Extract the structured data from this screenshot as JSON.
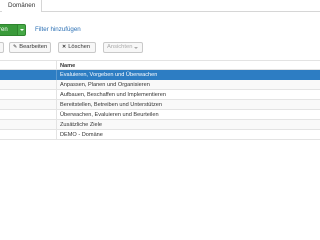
{
  "tabs": {
    "active_label": "Domänen"
  },
  "toolbar_top": {
    "add_label": "ren",
    "filter_link": "Filter hinzufügen"
  },
  "toolbar_actions": {
    "edit_label": "Bearbeiten",
    "delete_label": "Löschen",
    "views_label": "Ansichten"
  },
  "table": {
    "column_header": "Name",
    "rows": [
      {
        "name": "Evaluieren, Vorgeben und Überwachen",
        "selected": true
      },
      {
        "name": "Anpassen, Planen und Organisieren",
        "selected": false
      },
      {
        "name": "Aufbauen, Beschaffen und Implementieren",
        "selected": false
      },
      {
        "name": "Bereitstellen, Betreiben und Unterstützen",
        "selected": false
      },
      {
        "name": "Überwachen, Evaluieren und Beurteilen",
        "selected": false
      },
      {
        "name": "Zusätzliche Ziele",
        "selected": false
      },
      {
        "name": "DEMO - Domäne",
        "selected": false
      }
    ]
  },
  "colors": {
    "accent": "#2d7dc3",
    "add_button": "#3a9a3a",
    "link": "#2a6fb4"
  },
  "icons": {
    "edit": "pencil-icon",
    "delete": "x-icon",
    "views_dropdown": "chevron-down-icon"
  }
}
